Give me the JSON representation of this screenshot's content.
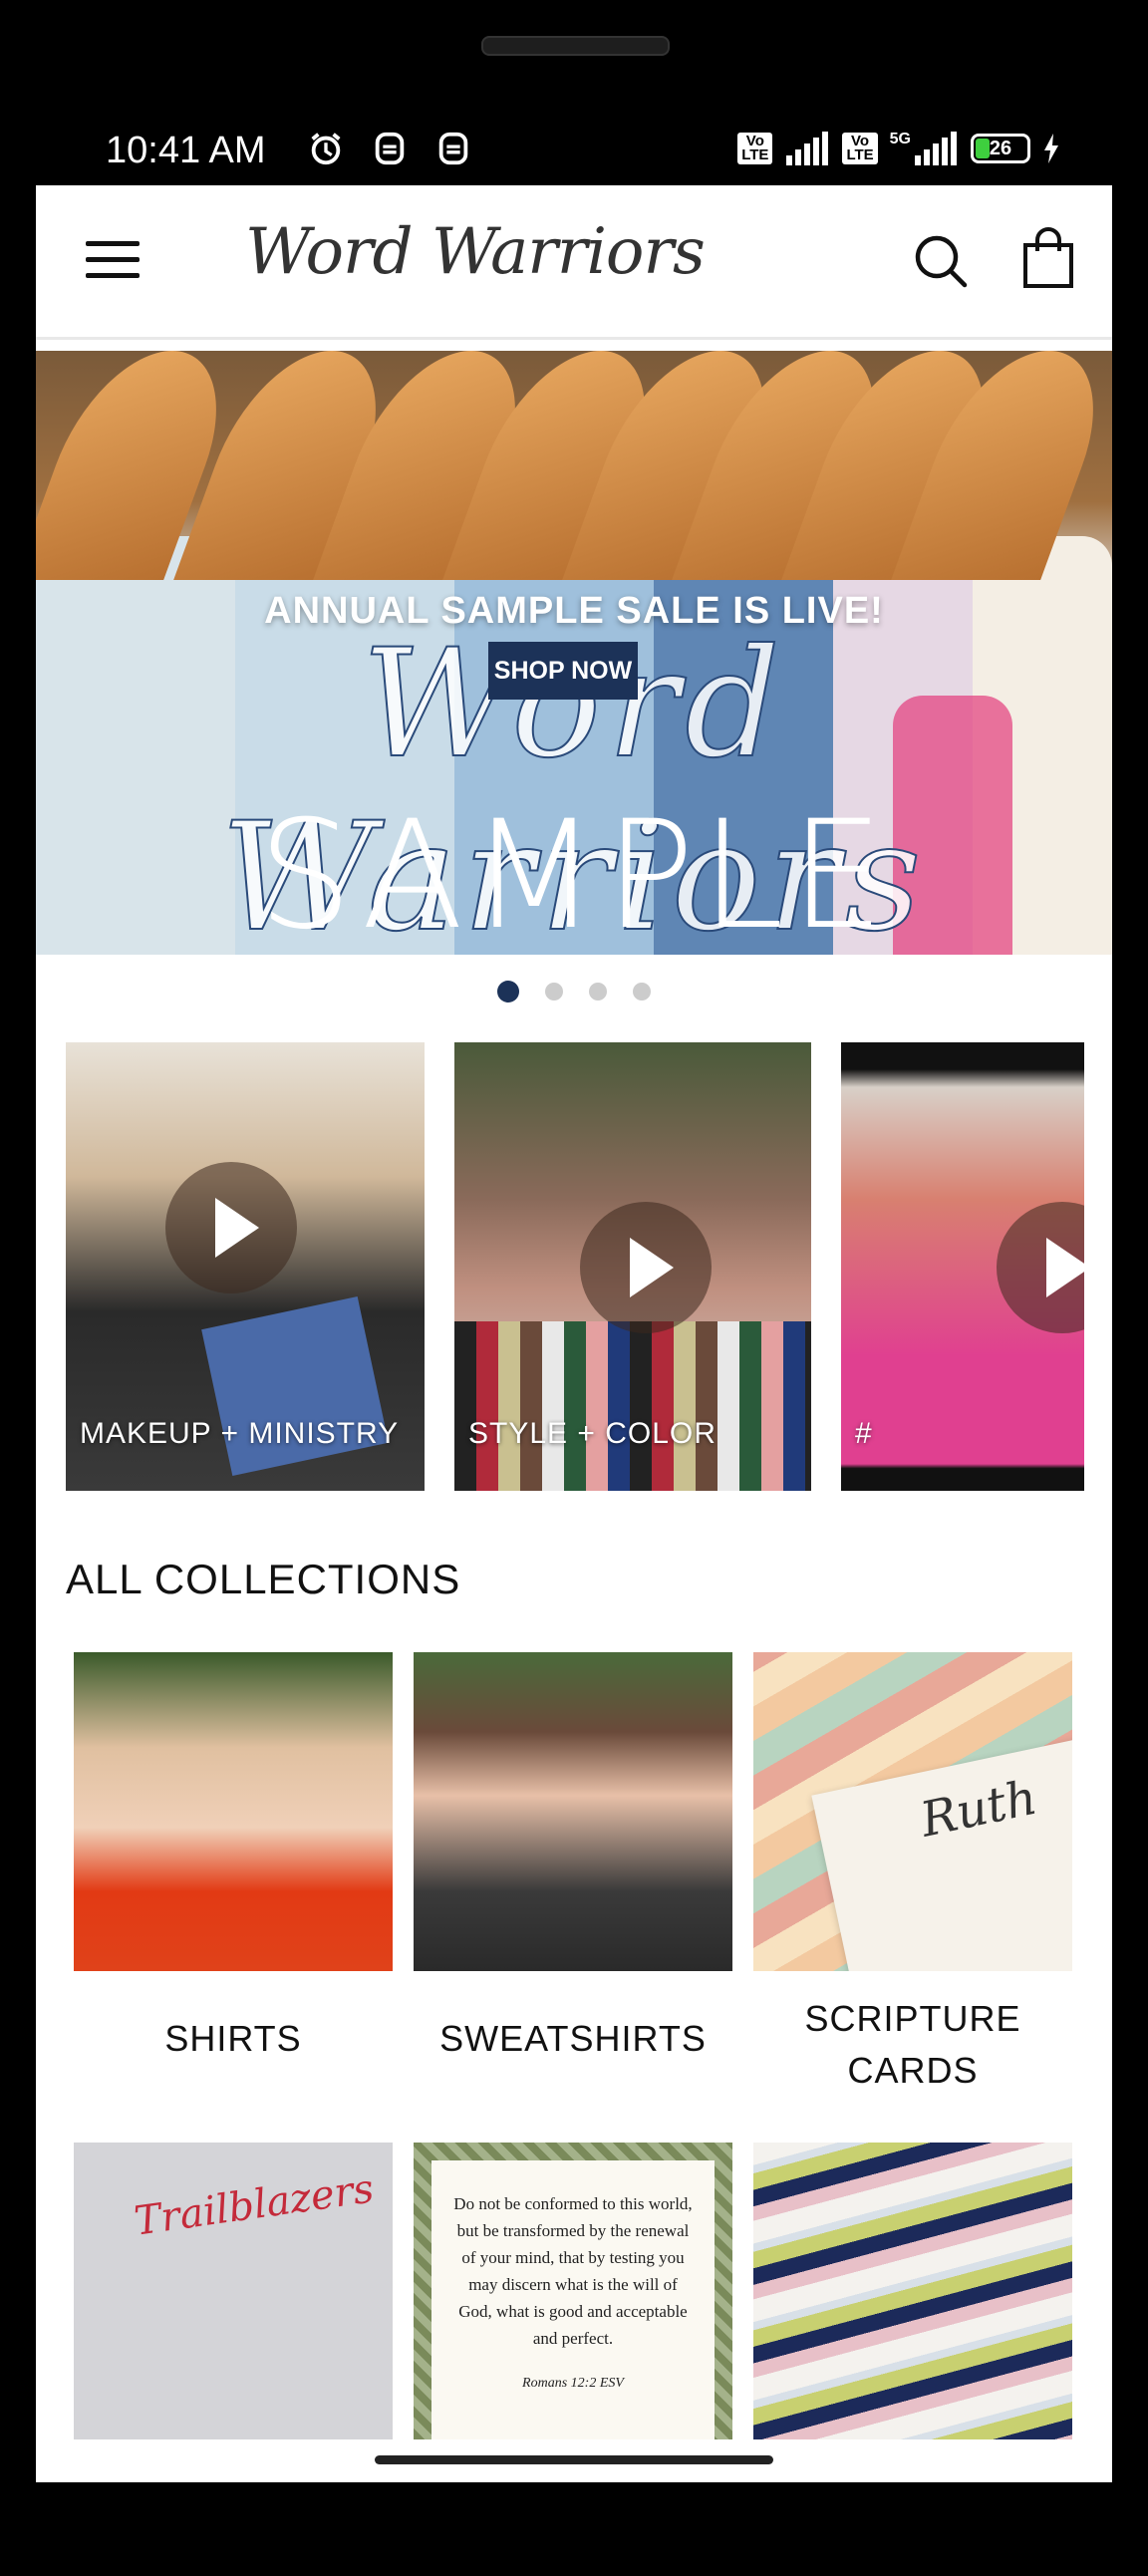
{
  "status_bar": {
    "time": "10:41 AM",
    "battery": "26",
    "net1": "Vo\nLTE",
    "net2": "Vo\nLTE",
    "net_5g": "5G"
  },
  "header": {
    "logo_text": "Word Warriors",
    "menu_icon": "hamburger-icon",
    "search_icon": "search-icon",
    "cart_icon": "shopping-bag-icon"
  },
  "hero": {
    "subtitle": "ANNUAL SAMPLE SALE IS LIVE!",
    "button_label": "SHOP NOW",
    "script_text": "Word Warriors",
    "headline": "SAMPLE SALE",
    "slide_count": 4,
    "active_slide": 1
  },
  "videos": [
    {
      "label": "MAKEUP + MINISTRY"
    },
    {
      "label": "STYLE + COLOR"
    },
    {
      "label": "#"
    }
  ],
  "collections": {
    "title": "ALL COLLECTIONS",
    "items": [
      {
        "label": "SHIRTS"
      },
      {
        "label": "SWEATSHIRTS"
      },
      {
        "label": "SCRIPTURE CARDS"
      },
      {
        "label": ""
      },
      {
        "label": ""
      },
      {
        "label": ""
      }
    ],
    "card_text": "Do not be conformed to this world, but be transformed by the renewal of your mind, that by testing you may discern what is the will of God, what is good and acceptable and perfect.",
    "card_ref": "Romans 12:2 ESV",
    "ruth_text": "Ruth",
    "trailblazers": "Trailblazers"
  },
  "colors": {
    "navy": "#1c3258",
    "text": "#111111"
  }
}
